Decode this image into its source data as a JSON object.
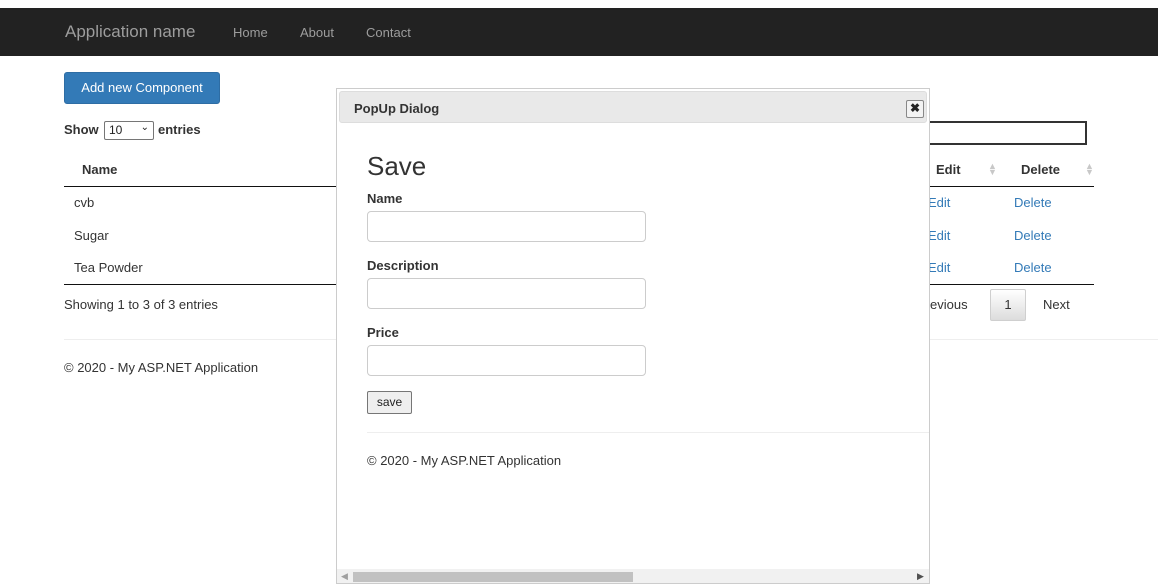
{
  "navbar": {
    "brand": "Application name",
    "links": [
      "Home",
      "About",
      "Contact"
    ]
  },
  "page": {
    "add_button": "Add new Component",
    "length_menu": {
      "prefix": "Show",
      "selected": "10",
      "suffix": "entries"
    },
    "table": {
      "columns": {
        "name": "Name",
        "edit": "Edit",
        "delete": "Delete"
      },
      "rows": [
        {
          "name": "cvb",
          "edit": "Edit",
          "delete": "Delete"
        },
        {
          "name": "Sugar",
          "edit": "Edit",
          "delete": "Delete"
        },
        {
          "name": "Tea Powder",
          "edit": "Edit",
          "delete": "Delete"
        }
      ]
    },
    "info": "Showing 1 to 3 of 3 entries",
    "pagination": {
      "previous": "evious",
      "current_page": "1",
      "next": "Next"
    },
    "footer": "© 2020 - My ASP.NET Application"
  },
  "dialog": {
    "title": "PopUp Dialog",
    "close_icon": "close-icon",
    "heading": "Save",
    "fields": {
      "name": {
        "label": "Name",
        "value": ""
      },
      "description": {
        "label": "Description",
        "value": ""
      },
      "price": {
        "label": "Price",
        "value": ""
      }
    },
    "save_button": "save",
    "footer": "© 2020 - My ASP.NET Application",
    "scrollbar_position": 0
  },
  "colors": {
    "navbar_bg": "#222222",
    "primary": "#337ab7",
    "link": "#337ab7"
  }
}
